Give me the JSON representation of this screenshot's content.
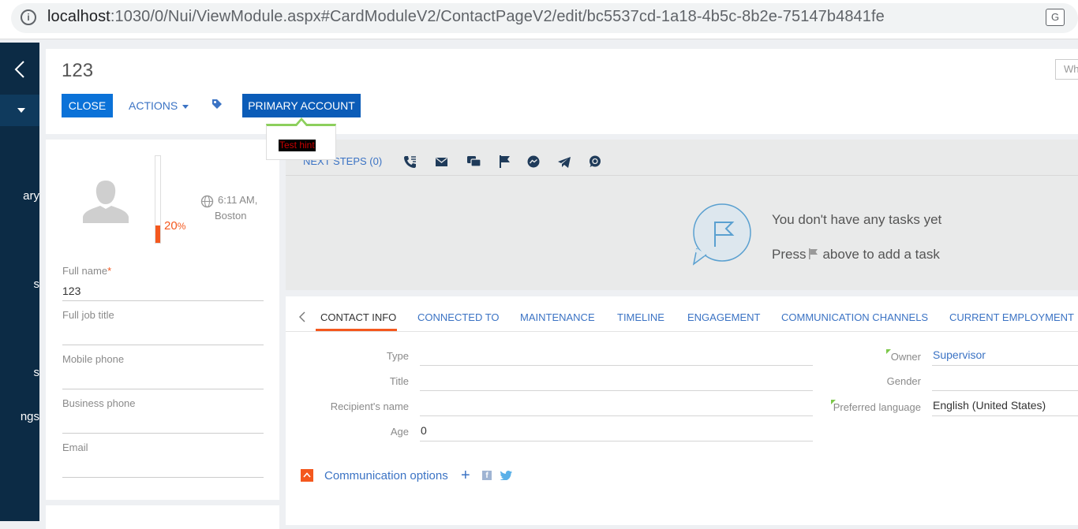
{
  "browser": {
    "info_icon": "info-icon",
    "url_host": "localhost",
    "url_rest": ":1030/0/Nui/ViewModule.aspx#CardModuleV2/ContactPageV2/edit/bc5537cd-1a18-4b5c-8b2e-75147b4841fe",
    "translate_icon": "translate-icon"
  },
  "sidebar": {
    "items": [
      {
        "label": "ary"
      },
      {
        "label": "s"
      },
      {
        "label": "s"
      },
      {
        "label": "ngs"
      }
    ]
  },
  "header": {
    "title": "123",
    "top_input_placeholder": "Wh",
    "close_label": "CLOSE",
    "actions_label": "ACTIONS",
    "primary_account_label": "PRIMARY ACCOUNT",
    "hint_text": "Test hint"
  },
  "profile": {
    "completeness_percent": 20,
    "completeness_value": "20",
    "completeness_unit": "%",
    "local_time": "6:11 AM,",
    "local_city": "Boston",
    "fields": {
      "full_name_label": "Full name",
      "full_name_required": "*",
      "full_name_value": "123",
      "job_title_label": "Full job title",
      "mobile_phone_label": "Mobile phone",
      "business_phone_label": "Business phone",
      "email_label": "Email"
    }
  },
  "next_steps": {
    "tab_label": "NEXT STEPS (0)",
    "icons": [
      "call-icon",
      "email-icon",
      "chat-icon",
      "flag-icon",
      "messenger-icon",
      "telegram-icon",
      "whatsapp-icon"
    ],
    "empty_line1": "You don't have any tasks yet",
    "empty_line2_prefix": "Press",
    "empty_line2_suffix": "above to add a task"
  },
  "details": {
    "tabs": [
      {
        "label": "CONTACT INFO",
        "active": true
      },
      {
        "label": "CONNECTED TO"
      },
      {
        "label": "MAINTENANCE"
      },
      {
        "label": "TIMELINE"
      },
      {
        "label": "ENGAGEMENT"
      },
      {
        "label": "COMMUNICATION CHANNELS"
      },
      {
        "label": "CURRENT EMPLOYMENT"
      }
    ],
    "left_fields": {
      "type_label": "Type",
      "title_label": "Title",
      "recipient_label": "Recipient's name",
      "age_label": "Age",
      "age_value": "0"
    },
    "right_fields": {
      "owner_label": "Owner",
      "owner_value": "Supervisor",
      "gender_label": "Gender",
      "language_label": "Preferred language",
      "language_value": "English (United States)"
    },
    "comm_options": {
      "title": "Communication options",
      "add_symbol": "+",
      "fb_glyph": "f"
    }
  },
  "colors": {
    "sidebar_bg": "#0c2b45",
    "primary_blue": "#0b72d8",
    "accent_orange": "#f4581e",
    "link_blue": "#3b73c4",
    "hint_green": "#8ccf5c"
  }
}
